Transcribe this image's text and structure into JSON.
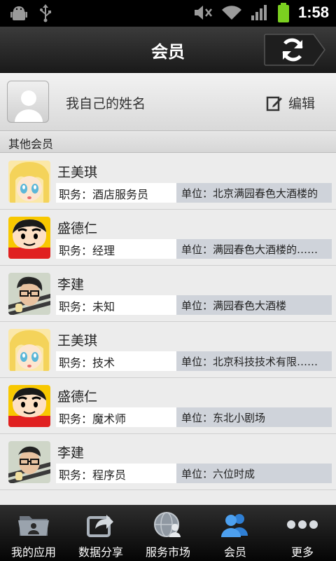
{
  "status_bar": {
    "time": "1:58"
  },
  "header": {
    "title": "会员",
    "refresh_icon": "refresh-icon"
  },
  "self": {
    "name": "我自己的姓名",
    "edit_label": "编辑"
  },
  "section": {
    "other_members_label": "其他会员"
  },
  "members": [
    {
      "name": "王美琪",
      "role": "职务：酒店服务员",
      "unit": "单位：北京满园春色大酒楼的",
      "avatar": "blonde-girl-avatar"
    },
    {
      "name": "盛德仁",
      "role": "职务：经理",
      "unit": "单位：满园春色大酒楼的……",
      "avatar": "cartoon-boy-avatar"
    },
    {
      "name": "李建",
      "role": "职务：未知",
      "unit": "单位：满园春色大酒楼",
      "avatar": "man-photo-avatar"
    },
    {
      "name": "王美琪",
      "role": "职务：技术",
      "unit": "单位：北京科技技术有限……",
      "avatar": "blonde-girl-avatar"
    },
    {
      "name": "盛德仁",
      "role": "职务：魔术师",
      "unit": "单位：东北小剧场",
      "avatar": "cartoon-boy-avatar"
    },
    {
      "name": "李建",
      "role": "职务：程序员",
      "unit": "单位：六位时成",
      "avatar": "man-photo-avatar"
    }
  ],
  "tabs": [
    {
      "label": "我的应用",
      "icon": "folder-icon"
    },
    {
      "label": "数据分享",
      "icon": "share-icon"
    },
    {
      "label": "服务市场",
      "icon": "globe-user-icon"
    },
    {
      "label": "会员",
      "icon": "members-icon",
      "active": true
    },
    {
      "label": "更多",
      "icon": "more-dots-icon"
    }
  ],
  "colors": {
    "accent_blue": "#3f8fe0",
    "titlebar": "#262626",
    "unit_bg": "#cfd3da"
  }
}
